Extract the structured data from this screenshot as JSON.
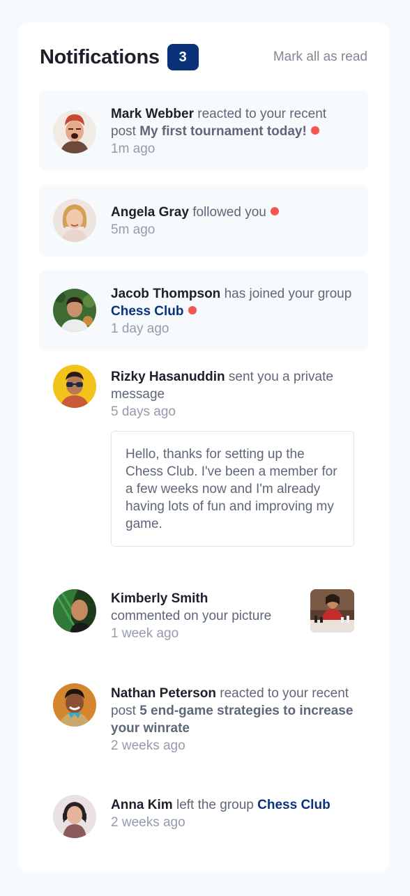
{
  "header": {
    "title": "Notifications",
    "unread_count": "3",
    "mark_all_label": "Mark all as read"
  },
  "notifications": [
    {
      "name": "Mark Webber",
      "action": " reacted to your recent post ",
      "target": "My first tournament today!",
      "time": "1m ago",
      "unread": true
    },
    {
      "name": "Angela Gray",
      "action": " followed you",
      "target": "",
      "time": "5m ago",
      "unread": true
    },
    {
      "name": "Jacob Thompson",
      "action": " has joined your group ",
      "target": "Chess Club",
      "time": "1 day ago",
      "unread": true
    },
    {
      "name": "Rizky Hasanuddin",
      "action": " sent you a private message",
      "target": "",
      "time": "5 days ago",
      "unread": false,
      "message": "Hello, thanks for setting up the Chess Club. I've been a member for a few weeks now and I'm already having lots of fun and improving my game."
    },
    {
      "name": "Kimberly Smith",
      "action": " commented on your picture",
      "target": "",
      "time": "1 week ago",
      "unread": false
    },
    {
      "name": "Nathan Peterson",
      "action": " reacted to your recent post ",
      "target": "5 end-game strategies to increase your winrate",
      "time": "2 weeks ago",
      "unread": false
    },
    {
      "name": "Anna Kim",
      "action": " left the group ",
      "target": "Chess Club",
      "time": "2 weeks ago",
      "unread": false
    }
  ],
  "colors": {
    "accent": "#0a327b",
    "unread_dot": "#f65552",
    "unread_bg": "#f6fafd"
  }
}
